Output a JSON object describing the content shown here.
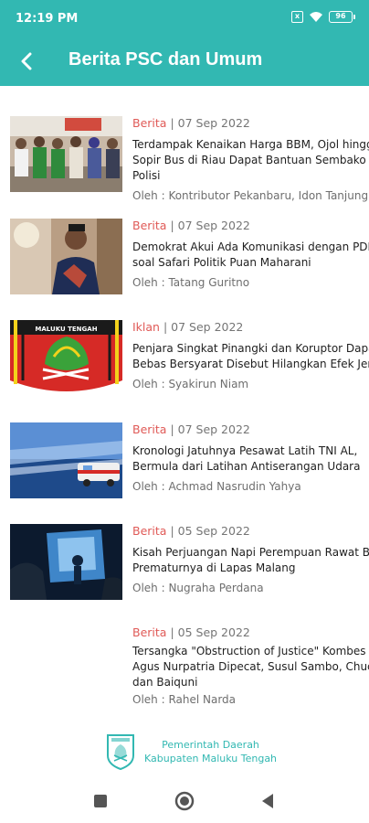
{
  "status_bar": {
    "time": "12:19 PM",
    "battery": "96",
    "sim_label": "x"
  },
  "app_bar": {
    "title": "Berita PSC dan Umum",
    "back_icon": "chevron-left-icon"
  },
  "colors": {
    "primary": "#32b8b2",
    "category": "#e05a57",
    "meta": "#757575",
    "title": "#1f1f1f"
  },
  "news": [
    {
      "category": "Berita",
      "date": "07 Sep 2022",
      "title": "Terdampak Kenaikan Harga BBM, Ojol hingga\nSopir Bus di Riau Dapat Bantuan Sembako dari\nPolisi",
      "author": "Oleh : Kontributor Pekanbaru, Idon Tanjung",
      "has_image": true
    },
    {
      "category": "Berita",
      "date": "07 Sep 2022",
      "title": "Demokrat Akui Ada Komunikasi dengan PDIP\nsoal Safari Politik Puan Maharani",
      "author": "Oleh : Tatang Guritno",
      "has_image": true
    },
    {
      "category": "Iklan",
      "date": "07 Sep 2022",
      "title": "Penjara Singkat Pinangki dan Koruptor Dapat\nBebas Bersyarat Disebut Hilangkan Efek Jera",
      "author": "Oleh : Syakirun Niam",
      "has_image": true,
      "image_caption": "MALUKU TENGAH"
    },
    {
      "category": "Berita",
      "date": "07 Sep 2022",
      "title": "Kronologi Jatuhnya Pesawat Latih TNI AL,\nBermula dari Latihan Antiserangan Udara",
      "author": "Oleh : Achmad Nasrudin Yahya",
      "has_image": true
    },
    {
      "category": "Berita",
      "date": "05 Sep 2022",
      "title": "Kisah Perjuangan Napi Perempuan Rawat Bayi\nPrematurnya di Lapas Malang",
      "author": "Oleh : Nugraha Perdana",
      "has_image": true
    },
    {
      "category": "Berita",
      "date": "05 Sep 2022",
      "title": "Tersangka \"Obstruction of Justice\" Kombes\nAgus Nurpatria Dipecat, Susul Sambo, Chuck,\ndan Baiquni",
      "author": "Oleh : Rahel Narda",
      "has_image": false
    }
  ],
  "footer": {
    "line1": "Pemerintah Daerah",
    "line2": "Kabupaten Maluku Tengah",
    "logo_icon": "maluku-tengah-crest-icon"
  },
  "nav_bar": {
    "recents_icon": "square-icon",
    "home_icon": "circle-icon",
    "back_icon": "triangle-back-icon"
  }
}
